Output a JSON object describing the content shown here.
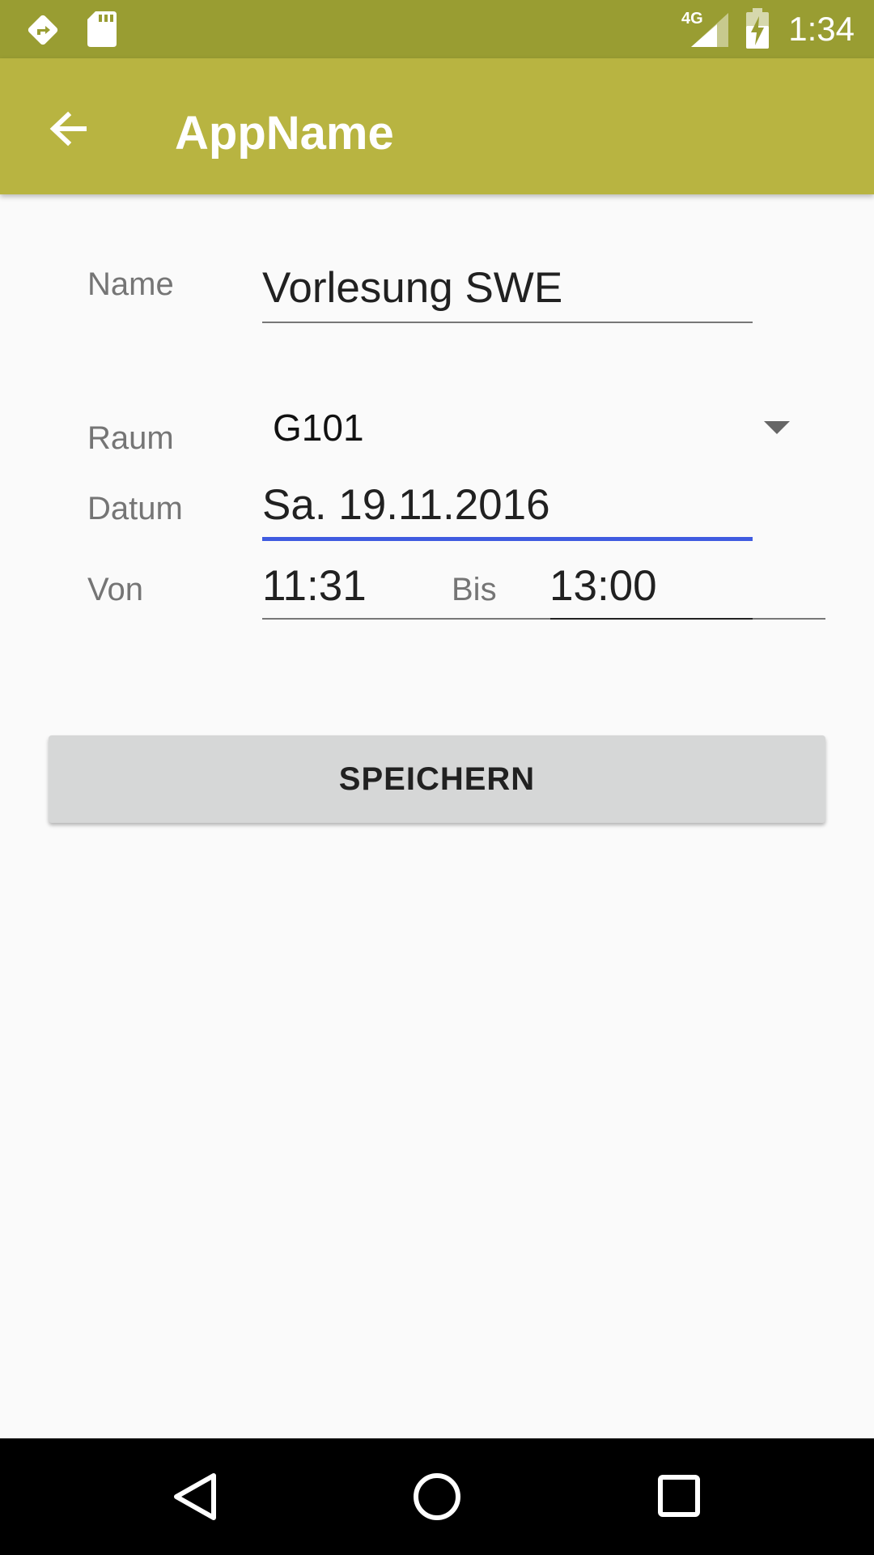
{
  "status_bar": {
    "network": "4G",
    "time": "1:34",
    "icons": [
      "directions-icon",
      "sd-card-icon",
      "signal-icon",
      "battery-charging-icon"
    ]
  },
  "app_bar": {
    "title": "AppName",
    "nav_icon": "arrow-back-icon"
  },
  "form": {
    "name_label": "Name",
    "name_value": "Vorlesung SWE",
    "room_label": "Raum",
    "room_value": "G101",
    "date_label": "Datum",
    "date_value": "Sa. 19.11.2016",
    "from_label": "Von",
    "from_value": "11:31",
    "to_label": "Bis",
    "to_value": "13:00"
  },
  "save_button": {
    "label": "SPEICHERN"
  },
  "nav_bar": {
    "icons": [
      "back-triangle-icon",
      "home-circle-icon",
      "recents-square-icon"
    ]
  },
  "colors": {
    "status_bar": "#999d32",
    "app_bar": "#b8b441",
    "focus_underline": "#3f5be0",
    "button": "#d6d7d7"
  }
}
